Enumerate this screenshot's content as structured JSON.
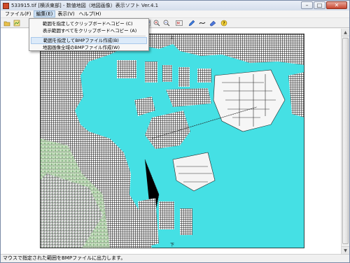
{
  "window": {
    "title": "533915.tif [横浜東部] - 数値地図（地図画像）表示ソフト Ver.4.1",
    "minimize_glyph": "–",
    "maximize_glyph": "□",
    "close_glyph": "✕"
  },
  "menubar": {
    "items": [
      "ファイル(F)",
      "編集(E)",
      "表示(V)",
      "ヘルプ(H)"
    ]
  },
  "edit_menu": {
    "items": [
      "範囲を指定してクリップボードへコピー (C)",
      "表示範囲すべてをクリップボードへコピー (A)",
      "範囲を指定してBMPファイル作成(B)",
      "地図画像全域のBMPファイル作成(W)"
    ]
  },
  "toolbar": {
    "icons": [
      "open-icon",
      "map-select-icon",
      "copy-area-icon",
      "bmp-icon",
      "zoom-in-icon",
      "zoom-out-icon",
      "fit-icon",
      "pen-icon",
      "line-icon",
      "eraser-icon",
      "help-icon"
    ]
  },
  "map": {
    "labels": [
      "上",
      "下"
    ]
  },
  "scrollbar": {
    "up": "▲",
    "down": "▼"
  },
  "status": {
    "text": "マウスで指定された範囲をBMPファイルに出力します。"
  },
  "colors": {
    "sea": "#45e0e4",
    "land": "#f2f2f2",
    "menu_highlight": "#dceaf9"
  }
}
